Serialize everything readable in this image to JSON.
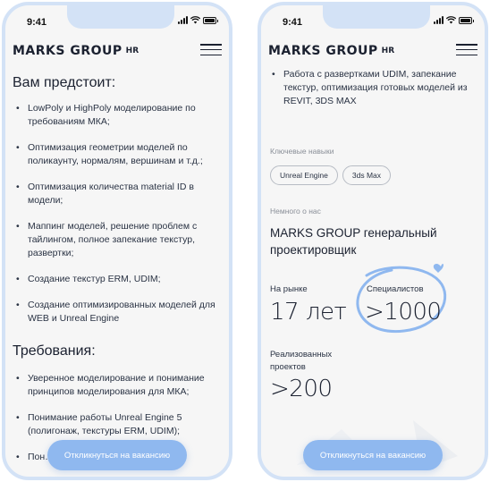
{
  "status_bar": {
    "time": "9:41"
  },
  "header": {
    "logo": "MARKS GROUP",
    "logo_suffix": "HR"
  },
  "left": {
    "section1_title": "Вам предстоит:",
    "tasks": [
      "LowPoly и HighPoly моделирование по требованиям МКА;",
      "Оптимизация геометрии моделей по поликаунту, нормалям, вершинам и т.д.;",
      "Оптимизация количества material ID в модели;",
      "Маппинг моделей, решение проблем с тайлингом, полное запекание текстур, развертки;",
      "Создание текстур ERM, UDIM;",
      "Создание оптимизированных моделей для WEB и Unreal Engine"
    ],
    "section2_title": "Требования:",
    "requirements": [
      "Уверенное моделирование и понимание принципов моделирования для МКА;",
      "Понимание работы Unreal Engine 5 (полигонаж, текстуры ERM, UDIM);",
      "Пон… в;"
    ],
    "cta_label": "Откликнуться на вакансию"
  },
  "right": {
    "top_item": "Работа с развертками UDIM, запекание текстур, оптимизация готовых моделей из REVIT, 3DS MAX",
    "skills_label": "Ключевые навыки",
    "skills": [
      "Unreal Engine",
      "3ds Max"
    ],
    "about_label": "Немного о нас",
    "about_text": "MARKS GROUP генеральный проектировщик",
    "stats": [
      {
        "label": "На рынке",
        "value": "17 лет"
      },
      {
        "label": "Специалистов",
        "value": ">1000"
      },
      {
        "label": "Реализованных проектов",
        "value": ">200"
      }
    ],
    "cta_label": "Откликнуться на вакансию"
  },
  "colors": {
    "frame": "#d3e2f6",
    "accent": "#8fb8ef",
    "circle": "#8fb8ef"
  }
}
